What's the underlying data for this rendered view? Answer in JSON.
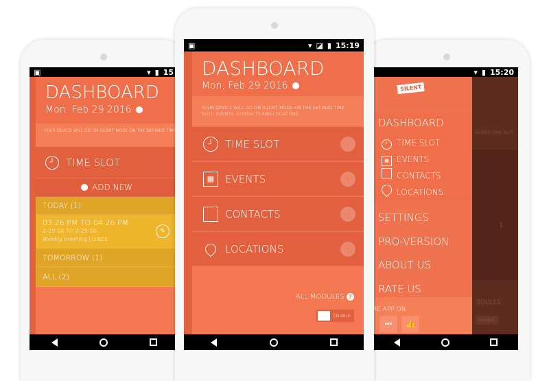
{
  "colors": {
    "accent": "#f37852",
    "header": "#ef6f4a",
    "row": "#e2603e",
    "yellow": "#efb52d",
    "overlay": "#5e2c1f"
  },
  "left": {
    "status_time": "15",
    "title": "DASHBOARD",
    "date": "Mon, Feb 29 2016",
    "info": "YOUR DEVICE WILL GO ON SILENT MODE ON THE DEFINED TIME SLOT, EVENTS, CONTACTS AND LOCATIONS",
    "section": "TIME SLOT",
    "add_new": "ADD NEW",
    "today": "TODAY (1)",
    "item": {
      "time": "03:26 PM TO 04:26 PM",
      "dates": "2-29-16 TO 2-29-16",
      "name": "Weekly meeting",
      "separator": "|",
      "repeat": "ONCE"
    },
    "tomorrow": "TOMORROW (1)",
    "all": "ALL (2)"
  },
  "middle": {
    "status_time": "15:19",
    "title": "DASHBOARD",
    "date": "Mon, Feb 29 2016",
    "info": "YOUR DEVICE WILL GO ON SILENT MODE ON THE DEFINED TIME SLOT, EVENTS, CONTACTS AND LOCATIONS",
    "modules": [
      {
        "label": "TIME SLOT",
        "icon": "clock-icon"
      },
      {
        "label": "EVENTS",
        "icon": "calendar-icon"
      },
      {
        "label": "CONTACTS",
        "icon": "contacts-icon"
      },
      {
        "label": "LOCATIONS",
        "icon": "location-pin-icon"
      }
    ],
    "all_modules": "ALL MODULES",
    "help": "?",
    "toggle_state": "off",
    "toggle_label": "ENABLE"
  },
  "right": {
    "status_time": "15:20",
    "logo": "SILENT",
    "menu": {
      "dashboard": "DASHBOARD",
      "sub": [
        "TIME SLOT",
        "EVENTS",
        "CONTACTS",
        "LOCATIONS"
      ],
      "settings": "SETTINGS",
      "pro": "PRO-VERSION",
      "about": "ABOUT US",
      "rate": "RATE US"
    },
    "share": "RE APP ON",
    "bg_text": "EFINED TIME SLOT,",
    "bg_count": "1",
    "bg_modules": "ODULES",
    "bg_enable": "ENABLE"
  }
}
